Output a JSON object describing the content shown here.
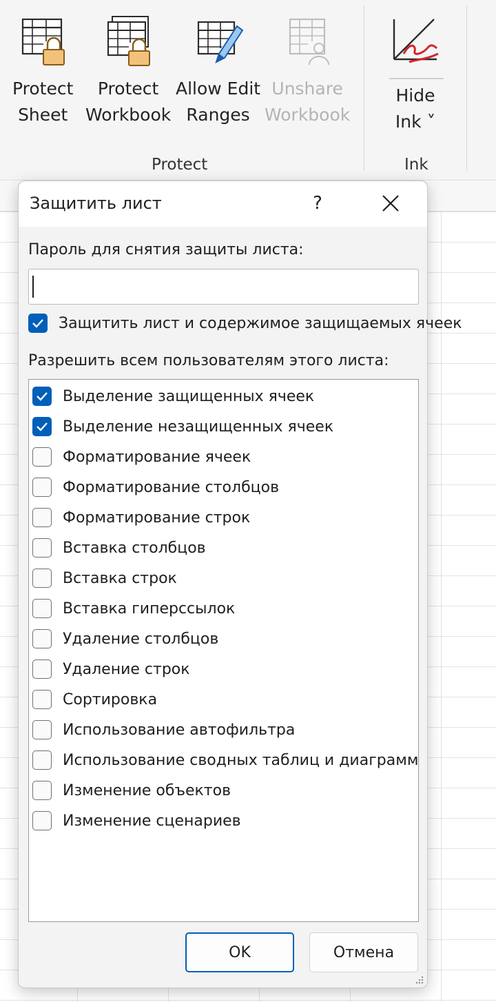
{
  "ribbon": {
    "buttons": [
      {
        "line1": "Protect",
        "line2": "Sheet"
      },
      {
        "line1": "Protect",
        "line2": "Workbook"
      },
      {
        "line1": "Allow Edit",
        "line2": "Ranges"
      },
      {
        "line1": "Unshare",
        "line2": "Workbook"
      },
      {
        "line1": "Hide",
        "line2": "Ink ˅"
      }
    ],
    "groups": {
      "protect": "Protect",
      "ink": "Ink"
    }
  },
  "dialog": {
    "title": "Защитить лист",
    "help": "?",
    "password_label": "Пароль для снятия защиты листа:",
    "password_value": "",
    "protect_checkbox_label": "Защитить лист и содержимое защищаемых ячеек",
    "protect_checked": true,
    "allow_label": "Разрешить всем пользователям этого листа:",
    "permissions": [
      {
        "label": "Выделение защищенных ячеек",
        "checked": true
      },
      {
        "label": "Выделение незащищенных ячеек",
        "checked": true
      },
      {
        "label": "Форматирование ячеек",
        "checked": false
      },
      {
        "label": "Форматирование столбцов",
        "checked": false
      },
      {
        "label": "Форматирование строк",
        "checked": false
      },
      {
        "label": "Вставка столбцов",
        "checked": false
      },
      {
        "label": "Вставка строк",
        "checked": false
      },
      {
        "label": "Вставка гиперссылок",
        "checked": false
      },
      {
        "label": "Удаление столбцов",
        "checked": false
      },
      {
        "label": "Удаление строк",
        "checked": false
      },
      {
        "label": "Сортировка",
        "checked": false
      },
      {
        "label": "Использование автофильтра",
        "checked": false
      },
      {
        "label": "Использование сводных таблиц и диаграмм",
        "checked": false
      },
      {
        "label": "Изменение объектов",
        "checked": false
      },
      {
        "label": "Изменение сценариев",
        "checked": false
      }
    ],
    "ok_label": "OK",
    "cancel_label": "Отмена"
  },
  "colors": {
    "accent": "#005fb8",
    "lock": "#f2c27a"
  }
}
